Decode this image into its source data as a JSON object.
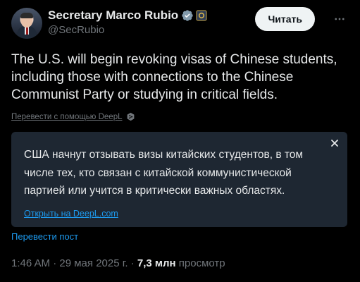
{
  "author": {
    "display_name": "Secretary Marco Rubio",
    "handle": "@SecRubio",
    "avatar_icon": "profile-photo",
    "verified_icon": "verified-badge-icon",
    "seal_icon": "state-department-seal-icon"
  },
  "follow_button": {
    "label": "Читать"
  },
  "tweet": {
    "text": "The U.S. will begin revoking visas of Chinese students, including those with connections to the Chinese Communist Party or studying in critical fields."
  },
  "translated_by": {
    "label": "Перевести с помощью DeepL"
  },
  "translation_card": {
    "text": "США начнут отзывать визы китайских студентов, в том числе тех, кто связан с китайской коммунистической партией или учится в критически важных областях.",
    "link_label": "Открыть на DeepL.com"
  },
  "translate_post": {
    "label": "Перевести пост"
  },
  "meta": {
    "time": "1:46 AM",
    "separator1": "·",
    "date": "29 мая 2025 г.",
    "separator2": "·",
    "views_count": "7,3 млн",
    "views_label": "просмотр"
  },
  "colors": {
    "background": "#000000",
    "text_primary": "#e7e9ea",
    "text_secondary": "#71767b",
    "accent": "#1d9bf0",
    "card_background": "#1e2732"
  }
}
